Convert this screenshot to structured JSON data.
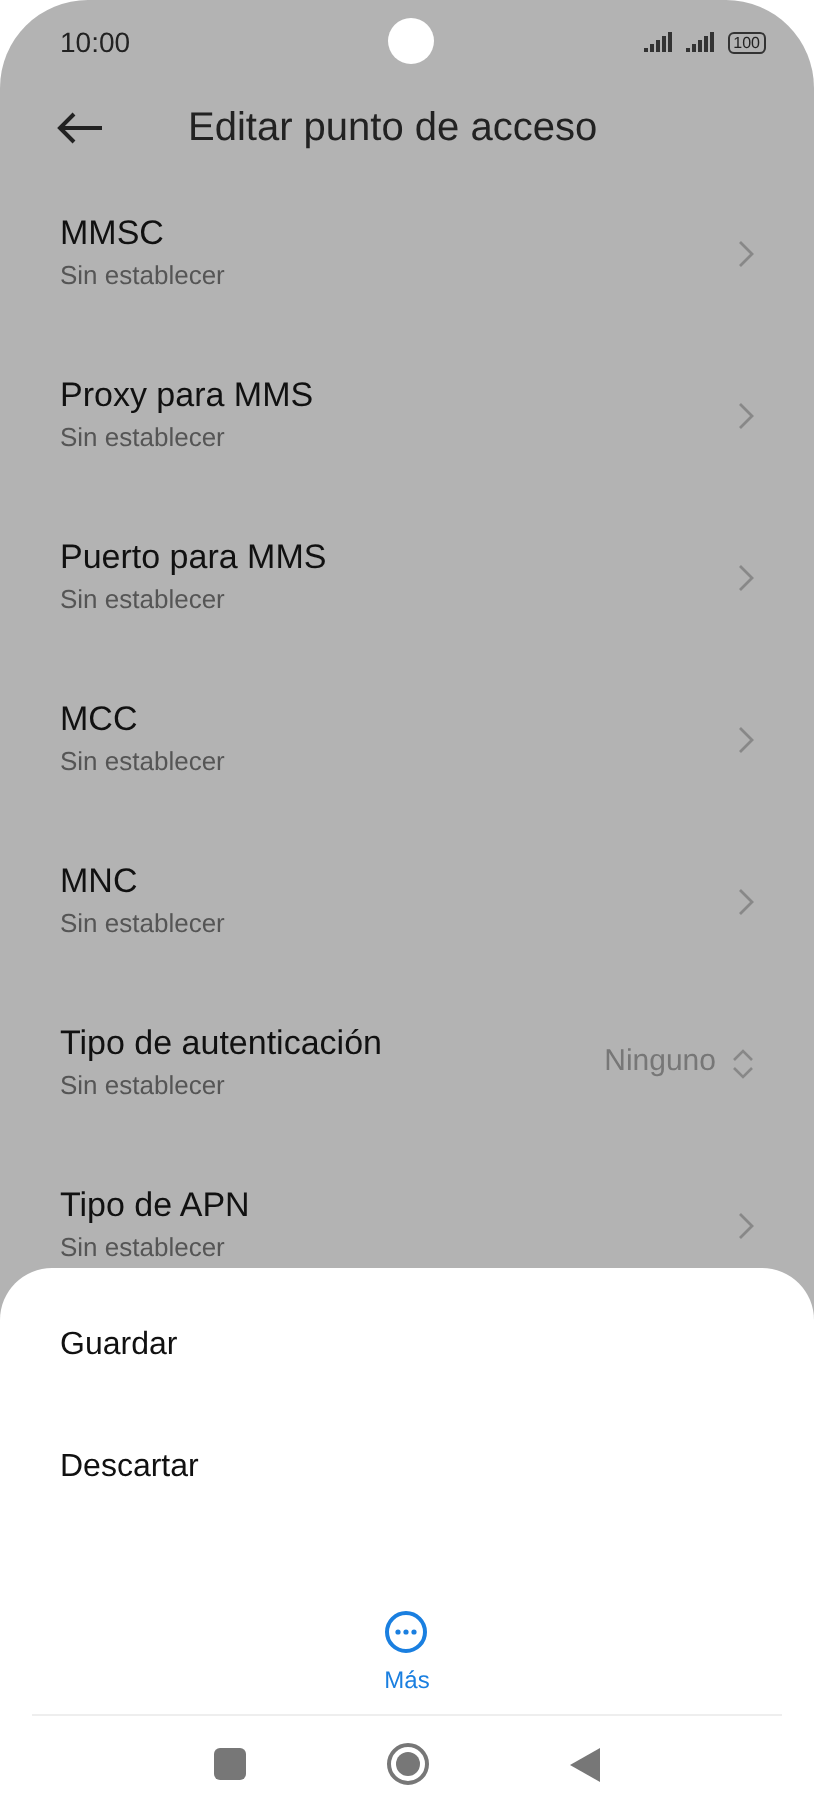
{
  "status_bar": {
    "time": "10:00",
    "battery": "100"
  },
  "header": {
    "title": "Editar punto de acceso"
  },
  "settings": [
    {
      "title": "MMSC",
      "subtitle": "Sin establecer",
      "kind": "chevron"
    },
    {
      "title": "Proxy para MMS",
      "subtitle": "Sin establecer",
      "kind": "chevron"
    },
    {
      "title": "Puerto para MMS",
      "subtitle": "Sin establecer",
      "kind": "chevron"
    },
    {
      "title": "MCC",
      "subtitle": "Sin establecer",
      "kind": "chevron"
    },
    {
      "title": "MNC",
      "subtitle": "Sin establecer",
      "kind": "chevron"
    },
    {
      "title": "Tipo de autenticación",
      "subtitle": "Sin establecer",
      "kind": "select",
      "value": "Ninguno"
    },
    {
      "title": "Tipo de APN",
      "subtitle": "Sin establecer",
      "kind": "chevron"
    }
  ],
  "sheet": {
    "options": [
      "Guardar",
      "Descartar"
    ],
    "more_label": "Más"
  }
}
